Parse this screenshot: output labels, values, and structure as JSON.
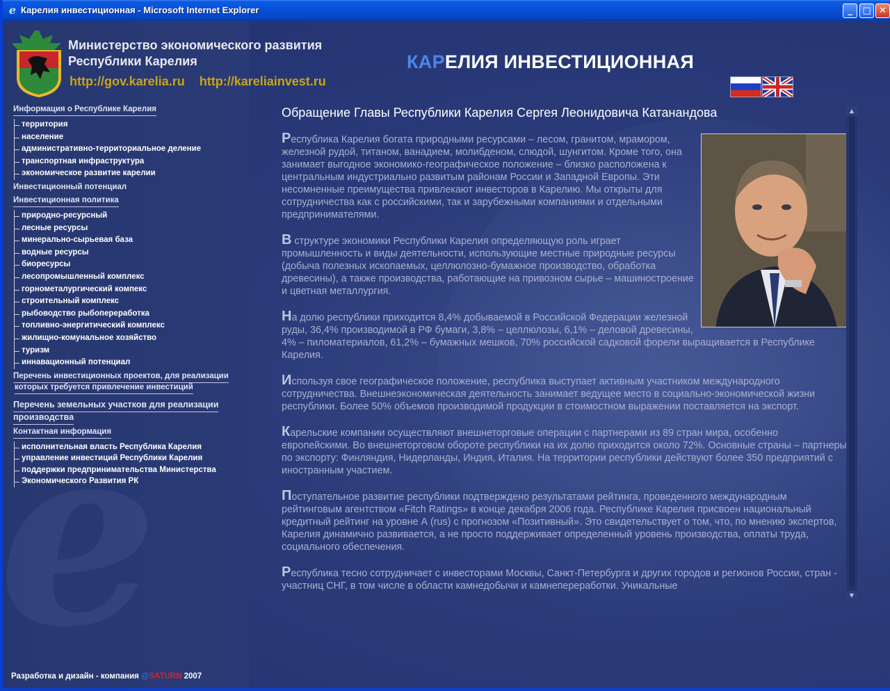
{
  "window": {
    "title": "Карелия инвестиционная - Microsoft Internet Explorer",
    "buttons": {
      "minimize": "_",
      "maximize": "□",
      "close": "✕"
    }
  },
  "header": {
    "ministry_line1": "Министерство экономического развития",
    "ministry_line2": "Республики Карелия",
    "url1": "http://gov.karelia.ru",
    "url2": "http://kareliainvest.ru",
    "site_title_accent": "КАР",
    "site_title_rest": "ЕЛИЯ ИНВЕСТИЦИОННАЯ"
  },
  "nav": {
    "section1": "Информация о Республике Карелия",
    "section1_items": [
      "территория",
      "население",
      "административно-территориальное деление",
      "транспортная инфраструктура",
      "экономическое развитие карелии"
    ],
    "section2": "Инвестиционный потенциал",
    "section3": "Инвестиционная политика",
    "section3_items": [
      "природно-ресурсный",
      "лесные ресурсы",
      "минерально-сырьевая база",
      "водные ресурсы",
      "биоресурсы",
      "лесопромышленный комплекс",
      "горнометалургический компекс",
      "строительный комплекс",
      "рыбоводство рыбопереработка",
      "топливно-энергитический комплекс",
      "жилищно-комунальное хозяйство",
      "туризм",
      "иннавационный потенциал"
    ],
    "section4_line1": "Перечень инвестиционных проектов, для реализации",
    "section4_line2": "которых  требуется привлечение инвестиций",
    "section5_line1": "Перечень земельных участков для реализации",
    "section5_line2": "производства",
    "section6": "Контактная информация",
    "section6_items": [
      "исполнительная власть Республика Карелия",
      "управление инвестиций Республики Карелия",
      "поддержки предпринимательства Министерства",
      "Экономического Развития РК"
    ]
  },
  "article": {
    "title": "Обращение Главы Республики Карелия Сергея Леонидовича Катанандова",
    "paragraphs": [
      {
        "cap": "Р",
        "text": "еспублика Карелия богата природными ресурсами – лесом, гранитом, мрамором, железной рудой, титаном, ванадием, молибденом, слюдой, шунгитом. Кроме того, она занимает выгодное экономико-географическое положение – близко расположена к центральным индустриально развитым районам России и Западной Европы. Эти несомненные преимущества привлекают инвесторов в Карелию. Мы открыты для сотрудничества как с российскими, так и зарубежными компаниями и отдельными предпринимателями."
      },
      {
        "cap": "В",
        "text": "  структуре экономики Республики Карелия определяющую роль играет промышленность и виды деятельности, использующие местные природные ресурсы (добыча полезных ископаемых, целлюлозно-бумажное производство, обработка древесины), а также производства, работающие на привозном сырье – машиностроение и цветная металлургия."
      },
      {
        "cap": "Н",
        "text": "а долю республики приходится 8,4% добываемой в Российской Федерации железной руды, 36,4% производимой в РФ бумаги, 3,8% – целлюлозы, 6,1% – деловой древесины, 4% – пиломатериалов, 61,2% – бумажных мешков, 70% российской садковой форели выращивается в Республике Карелия."
      },
      {
        "cap": "И",
        "text": "спользуя свое географическое положение, республика выступает активным участником международного сотрудничества. Внешнеэкономическая деятельность занимает ведущее место в социально-экономической жизни республики. Более 50% объемов производимой продукции в стоимостном выражении поставляется на экспорт."
      },
      {
        "cap": "К",
        "text": "арельские компании осуществляют внешнеторговые операции с партнерами из 89 стран мира, особенно европейскими. Во внешнеторговом обороте республики на их долю приходится около 72%. Основные страны – партнеры по экспорту: Финляндия, Нидерланды, Индия, Италия. На территории республики действуют более 350 предприятий с иностранным участием."
      },
      {
        "cap": "П",
        "text": "оступательное развитие республики подтверждено результатами рейтинга, проведенного международным рейтинговым агентством «Fitch Ratings» в конце декабря 2006 года. Республике Карелия присвоен национальный кредитный рейтинг на уровне А (rus) с прогнозом «Позитивный». Это свидетельствует о том, что, по мнению экспертов, Карелия динамично развивается, а не просто поддерживает определенный уровень производства, оплаты труда, социального обеспечения."
      },
      {
        "cap": "Р",
        "text": "еспублика тесно сотрудничает с инвесторами Москвы, Санкт-Петербурга и других городов и регионов России, стран - участниц СНГ, в том числе в области камнедобычи и камнепереработки. Уникальные"
      }
    ]
  },
  "footer": {
    "prefix": "Разработка и дизайн - компания",
    "at": "@",
    "brand": "SATURN",
    "year": "2007"
  }
}
